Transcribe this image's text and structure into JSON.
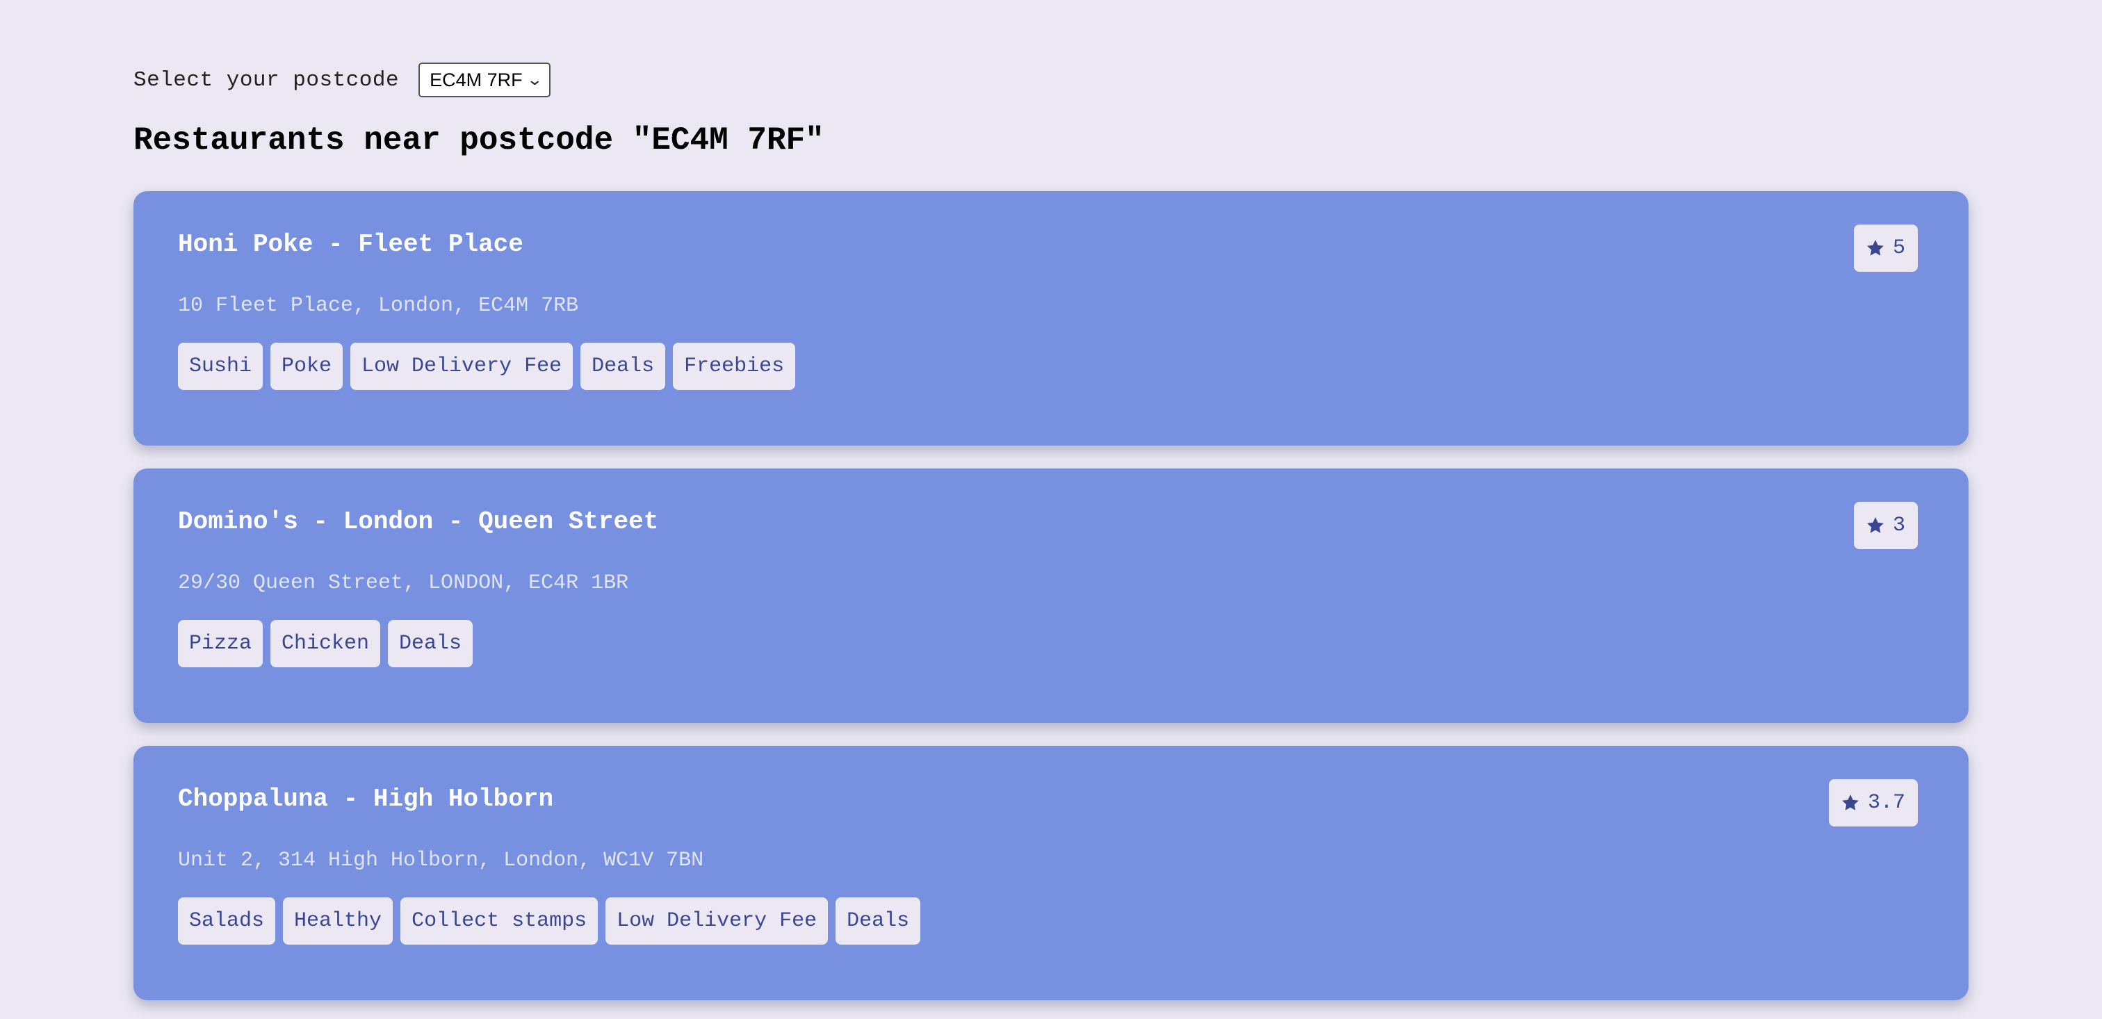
{
  "postcode": {
    "label": "Select your postcode",
    "selected": "EC4M 7RF"
  },
  "page": {
    "title": "Restaurants near postcode \"EC4M 7RF\""
  },
  "colors": {
    "background": "#ebe8f4",
    "card": "#7890e0",
    "tag_text": "#3a4690"
  },
  "restaurants": [
    {
      "name": "Honi Poke - Fleet Place",
      "address": "10 Fleet Place, London, EC4M 7RB",
      "rating": "5",
      "tags": [
        "Sushi",
        "Poke",
        "Low Delivery Fee",
        "Deals",
        "Freebies"
      ]
    },
    {
      "name": "Domino's - London - Queen Street",
      "address": "29/30 Queen Street, LONDON, EC4R 1BR",
      "rating": "3",
      "tags": [
        "Pizza",
        "Chicken",
        "Deals"
      ]
    },
    {
      "name": "Choppaluna - High Holborn",
      "address": "Unit 2, 314 High Holborn, London, WC1V 7BN",
      "rating": "3.7",
      "tags": [
        "Salads",
        "Healthy",
        "Collect stamps",
        "Low Delivery Fee",
        "Deals"
      ]
    }
  ]
}
